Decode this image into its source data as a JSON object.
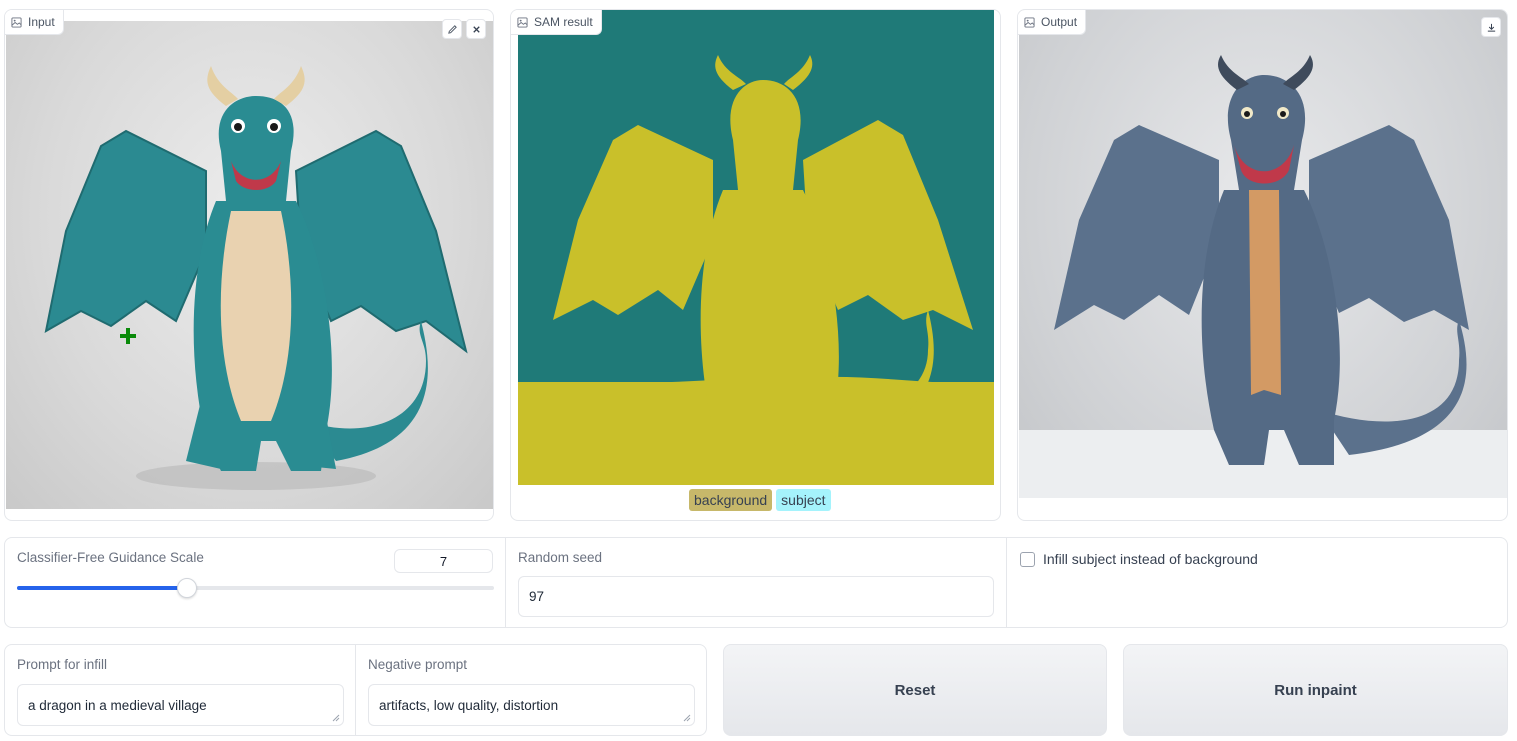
{
  "input_panel": {
    "label": "Input",
    "icons": [
      "image-icon",
      "edit-icon",
      "close-icon"
    ]
  },
  "sam_panel": {
    "label": "SAM result",
    "legend": [
      {
        "text": "background",
        "color": "#c7b86a"
      },
      {
        "text": "subject",
        "color": "#a5f3fc"
      }
    ]
  },
  "output_panel": {
    "label": "Output",
    "icons": [
      "image-icon",
      "download-icon"
    ]
  },
  "cfg": {
    "label": "Classifier-Free Guidance Scale",
    "value": "7",
    "slider_fraction": 0.356
  },
  "seed": {
    "label": "Random seed",
    "value": "97"
  },
  "infill_subject": {
    "label": "Infill subject instead of background",
    "checked": false
  },
  "prompt": {
    "label": "Prompt for infill",
    "value": "a dragon in a medieval village"
  },
  "negative_prompt": {
    "label": "Negative prompt",
    "value": "artifacts, low quality, distortion"
  },
  "buttons": {
    "reset": "Reset",
    "run": "Run inpaint"
  },
  "colors": {
    "accent": "#2563eb",
    "sam_background": "#1f7a78",
    "sam_subject": "#c9c02a",
    "marker": "#0a8a0a"
  }
}
